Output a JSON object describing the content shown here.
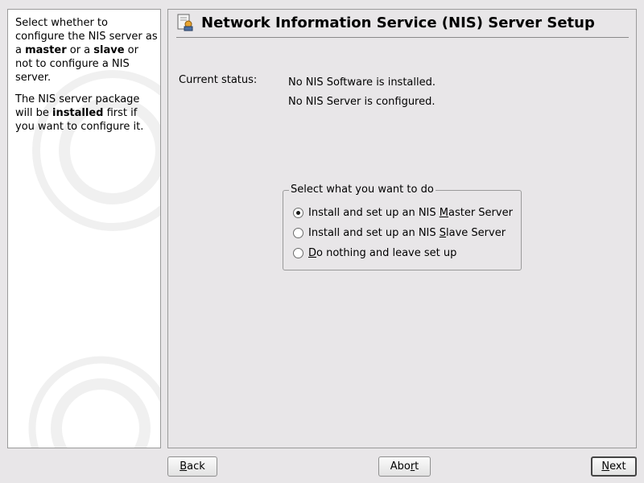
{
  "help": {
    "p1_part1": "Select whether to configure the NIS server as a ",
    "p1_bold1": "master",
    "p1_part2": " or a ",
    "p1_bold2": "slave",
    "p1_part3": " or not to configure a NIS server.",
    "p2_part1": "The NIS server package will be ",
    "p2_bold1": "installed",
    "p2_part2": " first if you want to configure it."
  },
  "header": {
    "title": "Network Information Service (NIS) Server Setup",
    "icon": "nis-server-icon"
  },
  "status": {
    "label": "Current status:",
    "line1": "No NIS Software is installed.",
    "line2": "No NIS Server is configured."
  },
  "group": {
    "title": "Select what you want to do",
    "options": [
      {
        "pre": "Install and set up an NIS ",
        "mn": "M",
        "post": "aster Server",
        "selected": true
      },
      {
        "pre": "Install and set up an NIS ",
        "mn": "S",
        "post": "lave Server",
        "selected": false
      },
      {
        "pre": "",
        "mn": "D",
        "post": "o nothing and leave set up",
        "selected": false
      }
    ]
  },
  "buttons": {
    "back_mn": "B",
    "back_rest": "ack",
    "abort_pre": "Abo",
    "abort_mn": "r",
    "abort_rest": "t",
    "next_mn": "N",
    "next_rest": "ext"
  },
  "colors": {
    "background": "#e8e6e8",
    "help_background": "#ffffff",
    "border": "#9a9a9a"
  }
}
